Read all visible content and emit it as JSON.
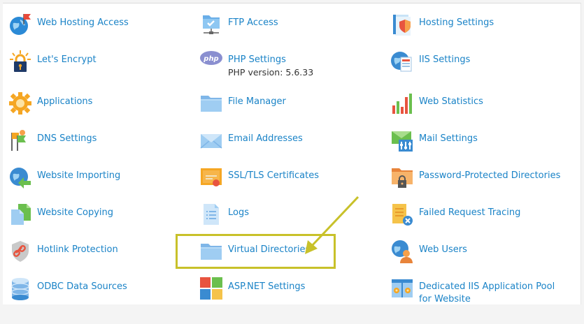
{
  "tools": [
    [
      {
        "name": "web-hosting-access",
        "label": "Web Hosting Access",
        "icon": "globe-flag-icon"
      },
      {
        "name": "ftp-access",
        "label": "FTP Access",
        "icon": "ftp-folder-icon"
      },
      {
        "name": "hosting-settings",
        "label": "Hosting Settings",
        "icon": "hosting-settings-icon"
      }
    ],
    [
      {
        "name": "lets-encrypt",
        "label": "Let's Encrypt",
        "icon": "lets-encrypt-lock-icon"
      },
      {
        "name": "php-settings",
        "label": "PHP Settings",
        "sub": "PHP version: 5.6.33",
        "icon": "php-icon"
      },
      {
        "name": "iis-settings",
        "label": "IIS Settings",
        "icon": "iis-globe-icon"
      }
    ],
    [
      {
        "name": "applications",
        "label": "Applications",
        "icon": "gear-icon"
      },
      {
        "name": "file-manager",
        "label": "File Manager",
        "icon": "folder-icon"
      },
      {
        "name": "web-statistics",
        "label": "Web Statistics",
        "icon": "bar-chart-icon"
      }
    ],
    [
      {
        "name": "dns-settings",
        "label": "DNS Settings",
        "icon": "dns-flags-icon"
      },
      {
        "name": "email-addresses",
        "label": "Email Addresses",
        "icon": "envelope-icon"
      },
      {
        "name": "mail-settings",
        "label": "Mail Settings",
        "icon": "mail-settings-icon"
      }
    ],
    [
      {
        "name": "website-importing",
        "label": "Website Importing",
        "icon": "globe-import-icon"
      },
      {
        "name": "ssl-tls-certificates",
        "label": "SSL/TLS Certificates",
        "icon": "certificate-icon"
      },
      {
        "name": "password-protected-directories",
        "label": "Password-Protected Directories",
        "icon": "locked-folder-icon"
      }
    ],
    [
      {
        "name": "website-copying",
        "label": "Website Copying",
        "icon": "copy-pages-icon"
      },
      {
        "name": "logs",
        "label": "Logs",
        "icon": "log-document-icon"
      },
      {
        "name": "failed-request-tracing",
        "label": "Failed Request Tracing",
        "icon": "failed-trace-icon"
      }
    ],
    [
      {
        "name": "hotlink-protection",
        "label": "Hotlink Protection",
        "icon": "hotlink-shield-icon"
      },
      {
        "name": "virtual-directories",
        "label": "Virtual Directories",
        "icon": "folder-icon"
      },
      {
        "name": "web-users",
        "label": "Web Users",
        "icon": "web-user-icon"
      }
    ],
    [
      {
        "name": "odbc-data-sources",
        "label": "ODBC Data Sources",
        "icon": "database-icon"
      },
      {
        "name": "aspnet-settings",
        "label": "ASP.NET Settings",
        "icon": "aspnet-tiles-icon"
      },
      {
        "name": "dedicated-iis-pool",
        "label": "Dedicated IIS Application Pool for Website",
        "icon": "iis-pool-icon"
      }
    ]
  ],
  "colors": {
    "link": "#1a83c7",
    "highlight": "#c8c12a"
  }
}
